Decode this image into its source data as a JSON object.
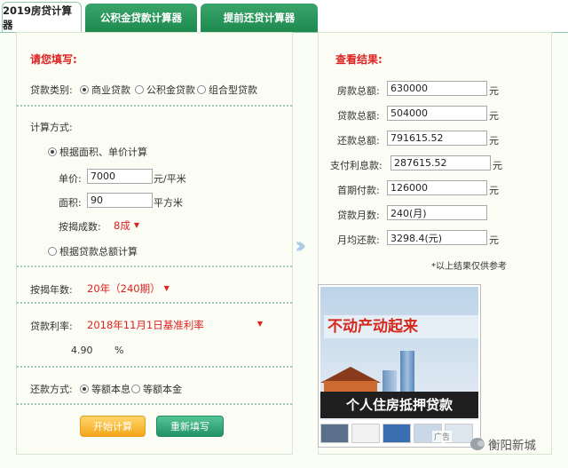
{
  "tabs": [
    {
      "label": "2019房贷计算器"
    },
    {
      "label": "公积金贷款计算器"
    },
    {
      "label": "提前还贷计算器"
    }
  ],
  "form": {
    "title": "请您填写:",
    "loan_type_label": "贷款类别:",
    "loan_types": [
      "商业贷款",
      "公积金贷款",
      "组合型贷款"
    ],
    "calc_method_label": "计算方式:",
    "method_area": "根据面积、单价计算",
    "unit_price_label": "单价:",
    "unit_price_value": "7000",
    "unit_price_unit": "元/平米",
    "area_label": "面积:",
    "area_value": "90",
    "area_unit": "平方米",
    "ratio_label": "按揭成数:",
    "ratio_value": "8成",
    "method_total": "根据贷款总额计算",
    "years_label": "按揭年数:",
    "years_value": "20年（240期）",
    "rate_label": "贷款利率:",
    "rate_value": "2018年11月1日基准利率",
    "rate_number": "4.90",
    "rate_unit": "%",
    "repay_label": "还款方式:",
    "repay_options": [
      "等额本息",
      "等额本金"
    ],
    "calc_button": "开始计算",
    "reset_button": "重新填写"
  },
  "results": {
    "title": "查看结果:",
    "rows": [
      {
        "label": "房款总额:",
        "value": "630000",
        "unit": "元"
      },
      {
        "label": "贷款总额:",
        "value": "504000",
        "unit": "元"
      },
      {
        "label": "还款总额:",
        "value": "791615.52",
        "unit": "元"
      },
      {
        "label": "支付利息款:",
        "value": "287615.52",
        "unit": "元"
      },
      {
        "label": "首期付款:",
        "value": "126000",
        "unit": "元"
      },
      {
        "label": "贷款月数:",
        "value": "240(月)",
        "unit": ""
      },
      {
        "label": "月均还款:",
        "value": "3298.4(元)",
        "unit": "元"
      }
    ],
    "note": "*以上结果仅供参考"
  },
  "ad": {
    "slogan": "不动产动起来",
    "banner": "个人住房抵押贷款",
    "badge": "广告"
  },
  "watermark": "衡阳新城"
}
